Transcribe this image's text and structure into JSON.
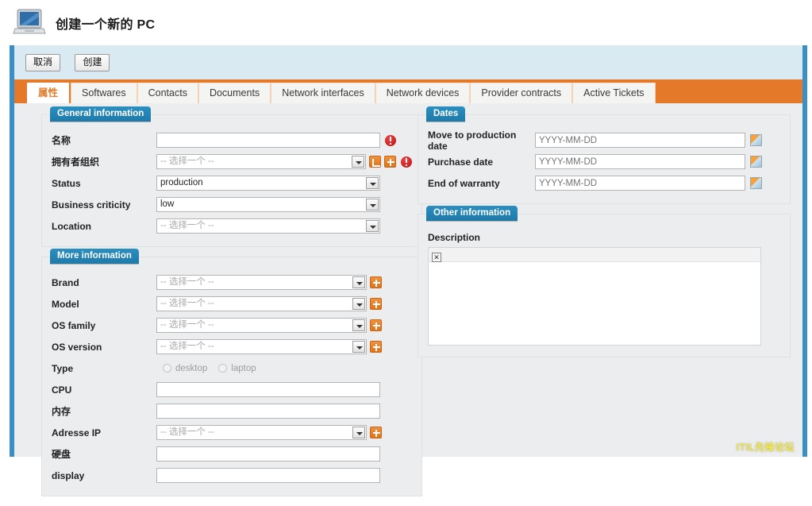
{
  "header": {
    "title": "创建一个新的 PC",
    "icon": "pc-laptop-icon"
  },
  "toolbar": {
    "cancel_label": "取消",
    "create_label": "创建"
  },
  "tabs": [
    {
      "label": "属性",
      "active": true
    },
    {
      "label": "Softwares",
      "active": false
    },
    {
      "label": "Contacts",
      "active": false
    },
    {
      "label": "Documents",
      "active": false
    },
    {
      "label": "Network interfaces",
      "active": false
    },
    {
      "label": "Network devices",
      "active": false
    },
    {
      "label": "Provider contracts",
      "active": false
    },
    {
      "label": "Active Tickets",
      "active": false
    }
  ],
  "panels": {
    "general": {
      "legend": "General information",
      "fields": {
        "name_label": "名称",
        "name_value": "",
        "owner_label": "拥有者组织",
        "owner_value": "-- 选择一个 --",
        "status_label": "Status",
        "status_value": "production",
        "criticity_label": "Business criticity",
        "criticity_value": "low",
        "location_label": "Location",
        "location_value": "-- 选择一个 --"
      }
    },
    "more": {
      "legend": "More information",
      "fields": {
        "brand_label": "Brand",
        "brand_value": "-- 选择一个 --",
        "model_label": "Model",
        "model_value": "-- 选择一个 --",
        "osfamily_label": "OS family",
        "osfamily_value": "-- 选择一个 --",
        "osversion_label": "OS version",
        "osversion_value": "-- 选择一个 --",
        "type_label": "Type",
        "type_option_desktop": "desktop",
        "type_option_laptop": "laptop",
        "cpu_label": "CPU",
        "cpu_value": "",
        "memory_label": "内存",
        "memory_value": "",
        "ip_label": "Adresse IP",
        "ip_value": "-- 选择一个 --",
        "disk_label": "硬盘",
        "disk_value": "",
        "display_label": "display",
        "display_value": ""
      }
    },
    "dates": {
      "legend": "Dates",
      "fields": {
        "move_label": "Move to production date",
        "move_placeholder": "YYYY-MM-DD",
        "purchase_label": "Purchase date",
        "purchase_placeholder": "YYYY-MM-DD",
        "warranty_label": "End of warranty",
        "warranty_placeholder": "YYYY-MM-DD"
      }
    },
    "other": {
      "legend": "Other information",
      "description_label": "Description",
      "description_value": "",
      "broken_image_glyph": "✕"
    }
  },
  "watermark": "ITIL先锋论坛",
  "colors": {
    "accent_orange": "#e4792a",
    "legend_blue": "#2a8fc0",
    "frame_blue": "#3a8fc4",
    "toolbar_blue": "#d9eaf2",
    "content_grey": "#ebedef",
    "error_red": "#b80f0f",
    "watermark_yellow": "#f2e84a"
  }
}
